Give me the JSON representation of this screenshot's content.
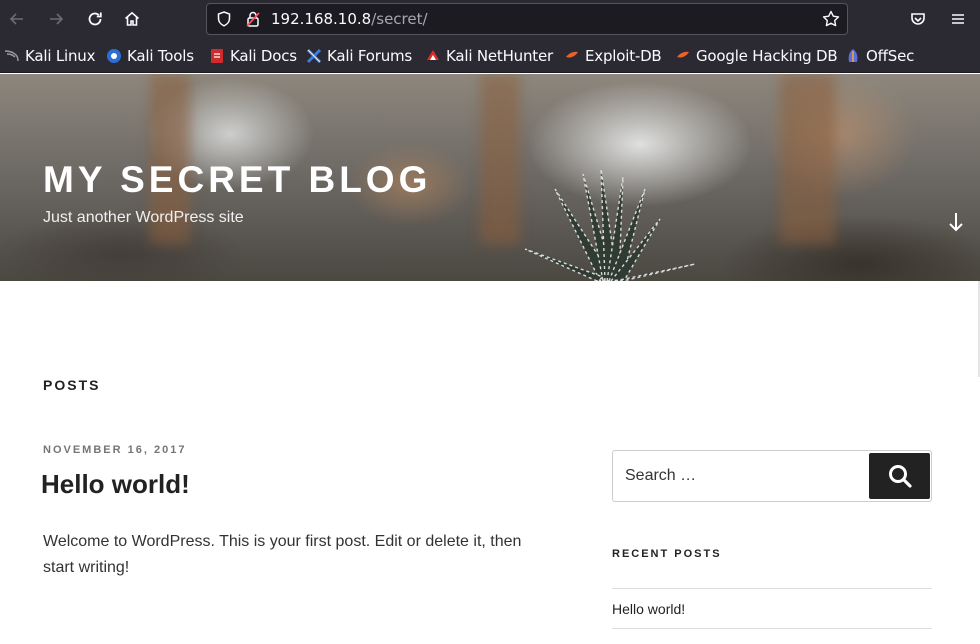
{
  "browser": {
    "url_host": "192.168.10.8",
    "url_path": "/secret/",
    "bookmarks": [
      {
        "label": "Kali Linux",
        "icon": "kali-dragon-icon",
        "color": "#3d3d3d"
      },
      {
        "label": "Kali Tools",
        "icon": "kali-tools-icon",
        "color": "#2b6fd6"
      },
      {
        "label": "Kali Docs",
        "icon": "kali-docs-icon",
        "color": "#d12a2a"
      },
      {
        "label": "Kali Forums",
        "icon": "kali-forums-icon",
        "color": "#3c7ce0"
      },
      {
        "label": "Kali NetHunter",
        "icon": "kali-nethunter-icon",
        "color": "#e02b2b"
      },
      {
        "label": "Exploit-DB",
        "icon": "exploit-db-icon",
        "color": "#e8622c"
      },
      {
        "label": "Google Hacking DB",
        "icon": "ghdb-icon",
        "color": "#e8622c"
      },
      {
        "label": "OffSec",
        "icon": "offsec-icon",
        "color": "#5b6fd6"
      }
    ]
  },
  "site": {
    "title": "MY SECRET BLOG",
    "description": "Just another WordPress site"
  },
  "main": {
    "section_heading": "POSTS",
    "post": {
      "date": "NOVEMBER 16, 2017",
      "title": "Hello world!",
      "excerpt": "Welcome to WordPress. This is your first post. Edit or delete it, then start writing!"
    }
  },
  "sidebar": {
    "search_placeholder": "Search …",
    "recent_heading": "RECENT POSTS",
    "recent_posts": [
      "Hello world!"
    ]
  },
  "colors": {
    "chrome_bg": "#2b2a33",
    "url_bg": "#1c1b22",
    "search_button": "#222222"
  }
}
